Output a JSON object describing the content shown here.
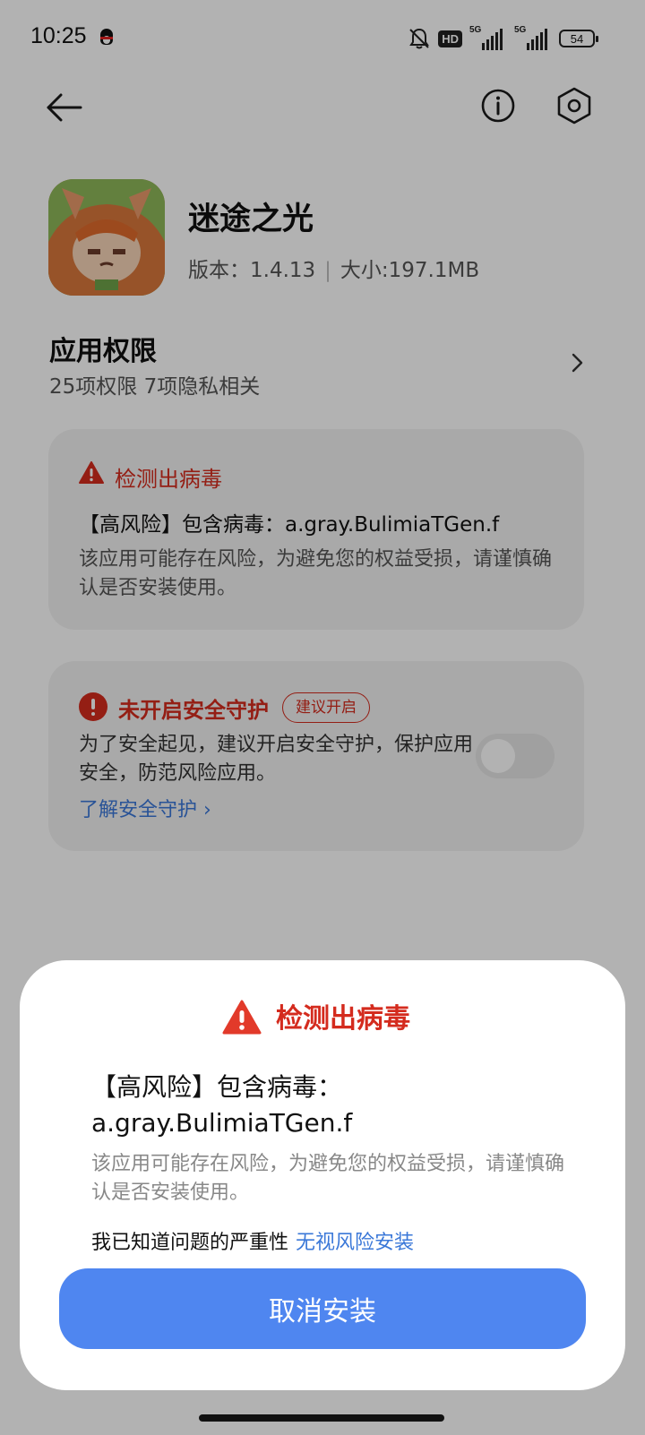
{
  "status_bar": {
    "time": "10:25",
    "hd_label": "HD",
    "sig1_label": "5G",
    "sig2_label": "5G",
    "battery": "54"
  },
  "app": {
    "name": "迷途之光",
    "version_label": "版本：1.4.13",
    "size_label": "大小:197.1MB"
  },
  "permissions": {
    "title": "应用权限",
    "subtitle": "25项权限 7项隐私相关"
  },
  "virus_card": {
    "title": "检测出病毒",
    "main": "【高风险】包含病毒：a.gray.BulimiaTGen.f",
    "desc": "该应用可能存在风险，为避免您的权益受损，请谨慎确认是否安装使用。"
  },
  "protect_card": {
    "title": "未开启安全守护",
    "badge": "建议开启",
    "desc": "为了安全起见，建议开启安全守护，保护应用安全，防范风险应用。",
    "link": "了解安全守护 ›",
    "toggle_on": false
  },
  "sheet": {
    "title": "检测出病毒",
    "main": "【高风险】包含病毒：a.gray.BulimiaTGen.f",
    "desc": "该应用可能存在风险，为避免您的权益受损，请谨慎确认是否安装使用。",
    "ack_text": "我已知道问题的严重性",
    "ack_link": "无视风险安装",
    "cancel_button": "取消安装"
  },
  "colors": {
    "warning_red": "#d42b1e",
    "link_blue": "#3b78d8",
    "button_blue": "#4f86f0"
  },
  "icons": [
    "back-arrow-icon",
    "info-icon",
    "settings-icon",
    "chevron-right-icon",
    "warning-triangle-icon",
    "alert-circle-icon",
    "mute-bell-icon"
  ]
}
